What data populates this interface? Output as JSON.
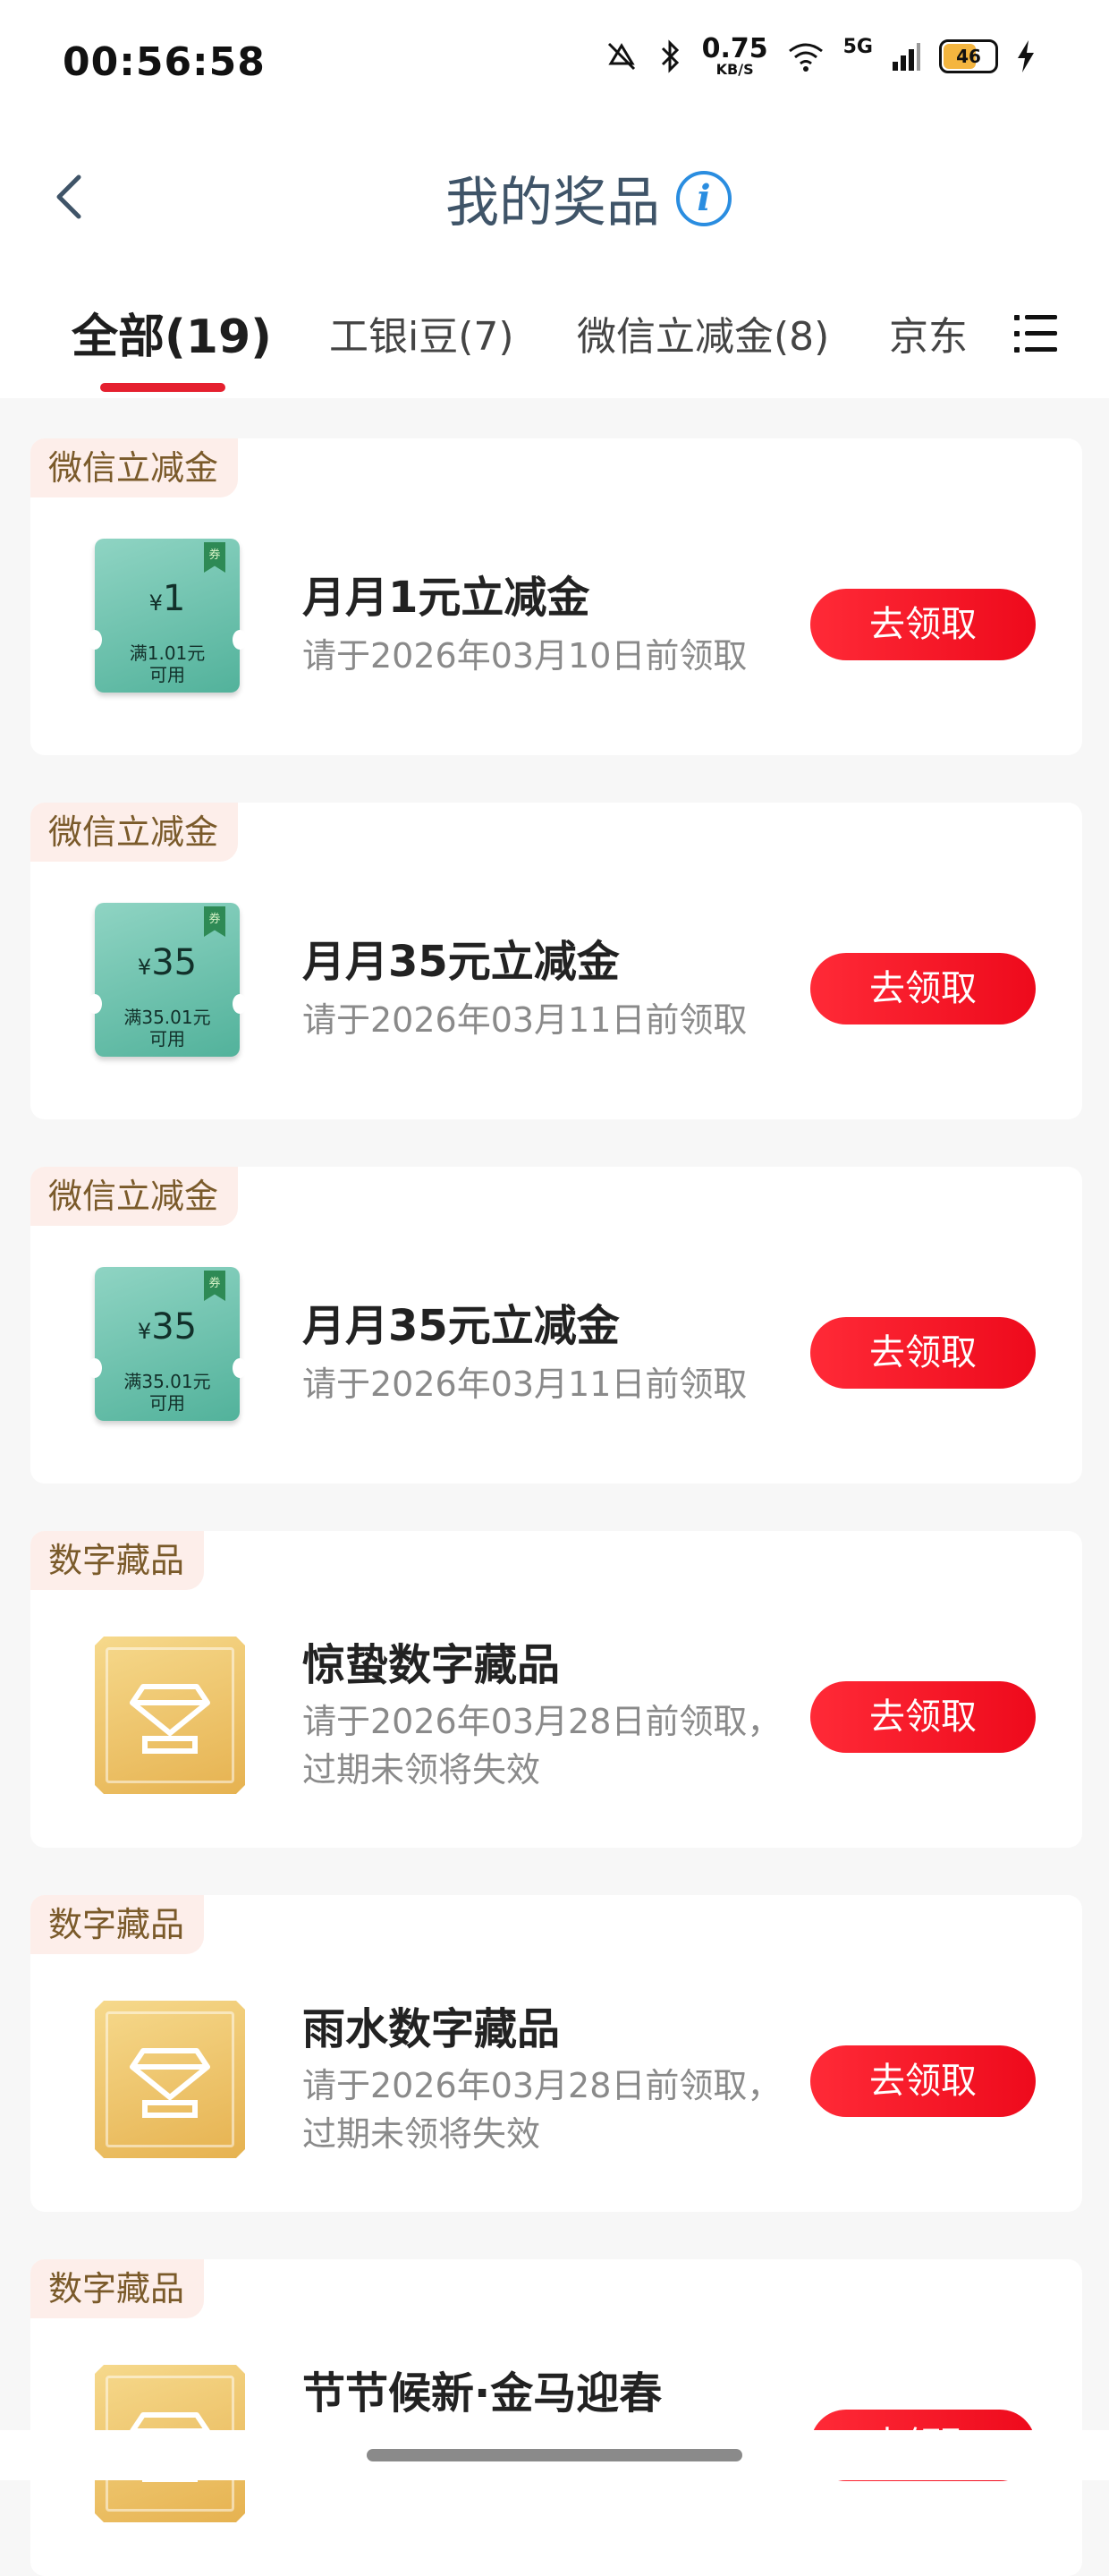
{
  "status_bar": {
    "time": "00:56:58",
    "net_speed_value": "0.75",
    "net_speed_unit": "KB/S",
    "network": "5G",
    "battery": "46"
  },
  "header": {
    "title": "我的奖品",
    "back_icon": "back-chevron-icon",
    "info_icon": "info-icon",
    "info_glyph": "i"
  },
  "tabs": [
    {
      "label": "全部(19)",
      "active": true
    },
    {
      "label": "工银i豆(7)",
      "active": false
    },
    {
      "label": "微信立减金(8)",
      "active": false
    },
    {
      "label": "京东",
      "active": false
    }
  ],
  "colors": {
    "accent": "#e5202f",
    "button": "#f51627",
    "tag_bg": "#fdeeea",
    "tag_text": "#7a5a2a",
    "coupon_green": "#52b29b",
    "nft_gold": "#e6b250"
  },
  "prizes": [
    {
      "category": "微信立减金",
      "type": "coupon",
      "amount": "1",
      "currency": "¥",
      "condition_1": "满1.01元",
      "condition_2": "可用",
      "badge": "券",
      "name": "月月1元立减金",
      "deadline_1": "请于2026年03月10日前领取",
      "deadline_2": "",
      "action": "去领取"
    },
    {
      "category": "微信立减金",
      "type": "coupon",
      "amount": "35",
      "currency": "¥",
      "condition_1": "满35.01元",
      "condition_2": "可用",
      "badge": "券",
      "name": "月月35元立减金",
      "deadline_1": "请于2026年03月11日前领取",
      "deadline_2": "",
      "action": "去领取"
    },
    {
      "category": "微信立减金",
      "type": "coupon",
      "amount": "35",
      "currency": "¥",
      "condition_1": "满35.01元",
      "condition_2": "可用",
      "badge": "券",
      "name": "月月35元立减金",
      "deadline_1": "请于2026年03月11日前领取",
      "deadline_2": "",
      "action": "去领取"
    },
    {
      "category": "数字藏品",
      "type": "nft",
      "name": "惊蛰数字藏品",
      "deadline_1": "请于2026年03月28日前领取，",
      "deadline_2": "过期未领将失效",
      "action": "去领取"
    },
    {
      "category": "数字藏品",
      "type": "nft",
      "name": "雨水数字藏品",
      "deadline_1": "请于2026年03月28日前领取，",
      "deadline_2": "过期未领将失效",
      "action": "去领取"
    },
    {
      "category": "数字藏品",
      "type": "nft",
      "name": "节节候新·金马迎春",
      "deadline_1": "",
      "deadline_2": "",
      "action": "去领取"
    }
  ]
}
